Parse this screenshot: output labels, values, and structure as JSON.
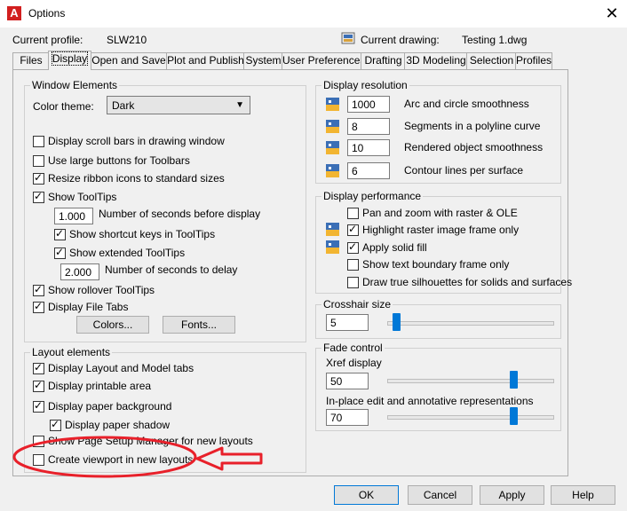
{
  "window": {
    "title": "Options",
    "app_icon_letter": "A",
    "close_glyph": "✕"
  },
  "profile": {
    "label": "Current profile:",
    "value": "SLW210"
  },
  "drawing": {
    "label": "Current drawing:",
    "value": "Testing 1.dwg"
  },
  "tabs": [
    "Files",
    "Display",
    "Open and Save",
    "Plot and Publish",
    "System",
    "User Preferences",
    "Drafting",
    "3D Modeling",
    "Selection",
    "Profiles"
  ],
  "window_elements": {
    "title": "Window Elements",
    "color_theme_label": "Color theme:",
    "color_theme_value": "Dark",
    "scroll_bars": "Display scroll bars in drawing window",
    "large_buttons": "Use large buttons for Toolbars",
    "resize_ribbon": "Resize ribbon icons to standard sizes",
    "show_tooltips": "Show ToolTips",
    "seconds_before_value": "1.000",
    "seconds_before_label": "Number of seconds before display",
    "shortcut_keys": "Show shortcut keys in ToolTips",
    "extended_tooltips": "Show extended ToolTips",
    "seconds_delay_value": "2.000",
    "seconds_delay_label": "Number of seconds to delay",
    "rollover_tooltips": "Show rollover ToolTips",
    "file_tabs": "Display File Tabs",
    "colors_button": "Colors...",
    "fonts_button": "Fonts..."
  },
  "layout_elements": {
    "title": "Layout elements",
    "layout_model_tabs": "Display Layout and Model tabs",
    "printable_area": "Display printable area",
    "paper_background": "Display paper background",
    "paper_shadow": "Display paper shadow",
    "page_setup_manager": "Show Page Setup Manager for new layouts",
    "create_viewport": "Create viewport in new layouts"
  },
  "display_resolution": {
    "title": "Display resolution",
    "rows": [
      {
        "value": "1000",
        "label": "Arc and circle smoothness"
      },
      {
        "value": "8",
        "label": "Segments in a polyline curve"
      },
      {
        "value": "10",
        "label": "Rendered object smoothness"
      },
      {
        "value": "6",
        "label": "Contour lines per surface"
      }
    ]
  },
  "display_performance": {
    "title": "Display performance",
    "pan_zoom": "Pan and zoom with raster & OLE",
    "highlight_raster": "Highlight raster image frame only",
    "apply_solid": "Apply solid fill",
    "text_boundary": "Show text boundary frame only",
    "true_silhouettes": "Draw true silhouettes for solids and surfaces"
  },
  "crosshair": {
    "title": "Crosshair size",
    "value": "5",
    "level": 5
  },
  "fade": {
    "title": "Fade control",
    "xref_label": "Xref display",
    "xref_value": "50",
    "inplace_label": "In-place edit and annotative representations",
    "inplace_value": "70"
  },
  "buttons": {
    "ok": "OK",
    "cancel": "Cancel",
    "apply": "Apply",
    "help": "Help"
  },
  "colors": {
    "annotation": "#e8202a",
    "accent": "#0078d7"
  }
}
